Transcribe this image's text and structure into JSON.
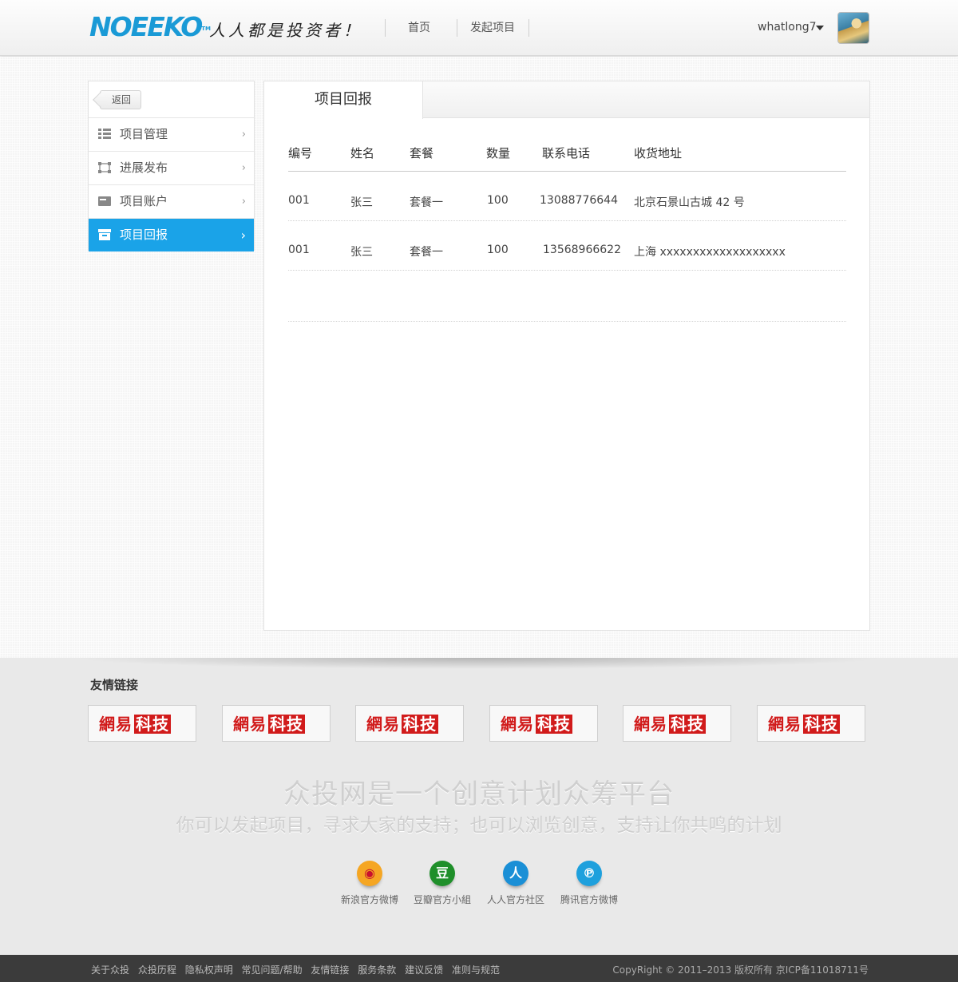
{
  "header": {
    "logo_text": "NOEEKO",
    "logo_tm": "TM",
    "slogan": "人人都是投资者！",
    "nav": [
      "首页",
      "发起项目"
    ],
    "username": "whatlong7"
  },
  "sidebar": {
    "back_label": "返回",
    "items": [
      {
        "label": "项目管理",
        "icon": "grid-list-icon",
        "active": false
      },
      {
        "label": "进展发布",
        "icon": "frame-icon",
        "active": false
      },
      {
        "label": "项目账户",
        "icon": "card-icon",
        "active": false
      },
      {
        "label": "项目回报",
        "icon": "archive-box-icon",
        "active": true
      }
    ],
    "chevron": "›"
  },
  "panel": {
    "tab_label": "项目回报",
    "columns": [
      "编号",
      "姓名",
      "套餐",
      "数量",
      "联系电话",
      "收货地址"
    ],
    "rows": [
      [
        "001",
        "张三",
        "套餐一",
        "100",
        "13088776644",
        "北京石景山古城 42 号"
      ],
      [
        "001",
        "张三",
        "套餐一",
        "100",
        "13568966622",
        "上海 xxxxxxxxxxxxxxxxxxx"
      ]
    ]
  },
  "footer": {
    "links_title": "友情链接",
    "partner_text": [
      "網易",
      "科技"
    ],
    "partner_count": 6,
    "tagline": "众投网是一个创意计划众筹平台",
    "subtagline": "你可以发起项目，寻求大家的支持；也可以浏览创意，支持让你共鸣的计划",
    "social": [
      {
        "label": "新浪官方微博",
        "icon": "weibo-icon",
        "color": "#f5a623",
        "glyph": "◉"
      },
      {
        "label": "豆瓣官方小組",
        "icon": "douban-icon",
        "color": "#1f8f2a",
        "glyph": "豆"
      },
      {
        "label": "人人官方社区",
        "icon": "renren-icon",
        "color": "#1a8fd6",
        "glyph": "人"
      },
      {
        "label": "腾讯官方微博",
        "icon": "tencent-weibo-icon",
        "color": "#1ea0dd",
        "glyph": "℗"
      }
    ],
    "bottom_links": [
      "关于众投",
      "众投历程",
      "隐私权声明",
      "常见问题/帮助",
      "友情链接",
      "服务条款",
      "建议反馈",
      "准则与规范"
    ],
    "copyright": "CopyRight © 2011–2013    版权所有  京ICP备11018711号"
  },
  "colors": {
    "accent": "#1aa3e8",
    "logo": "#1a9ad6",
    "partner_red": "#d11b1b"
  }
}
